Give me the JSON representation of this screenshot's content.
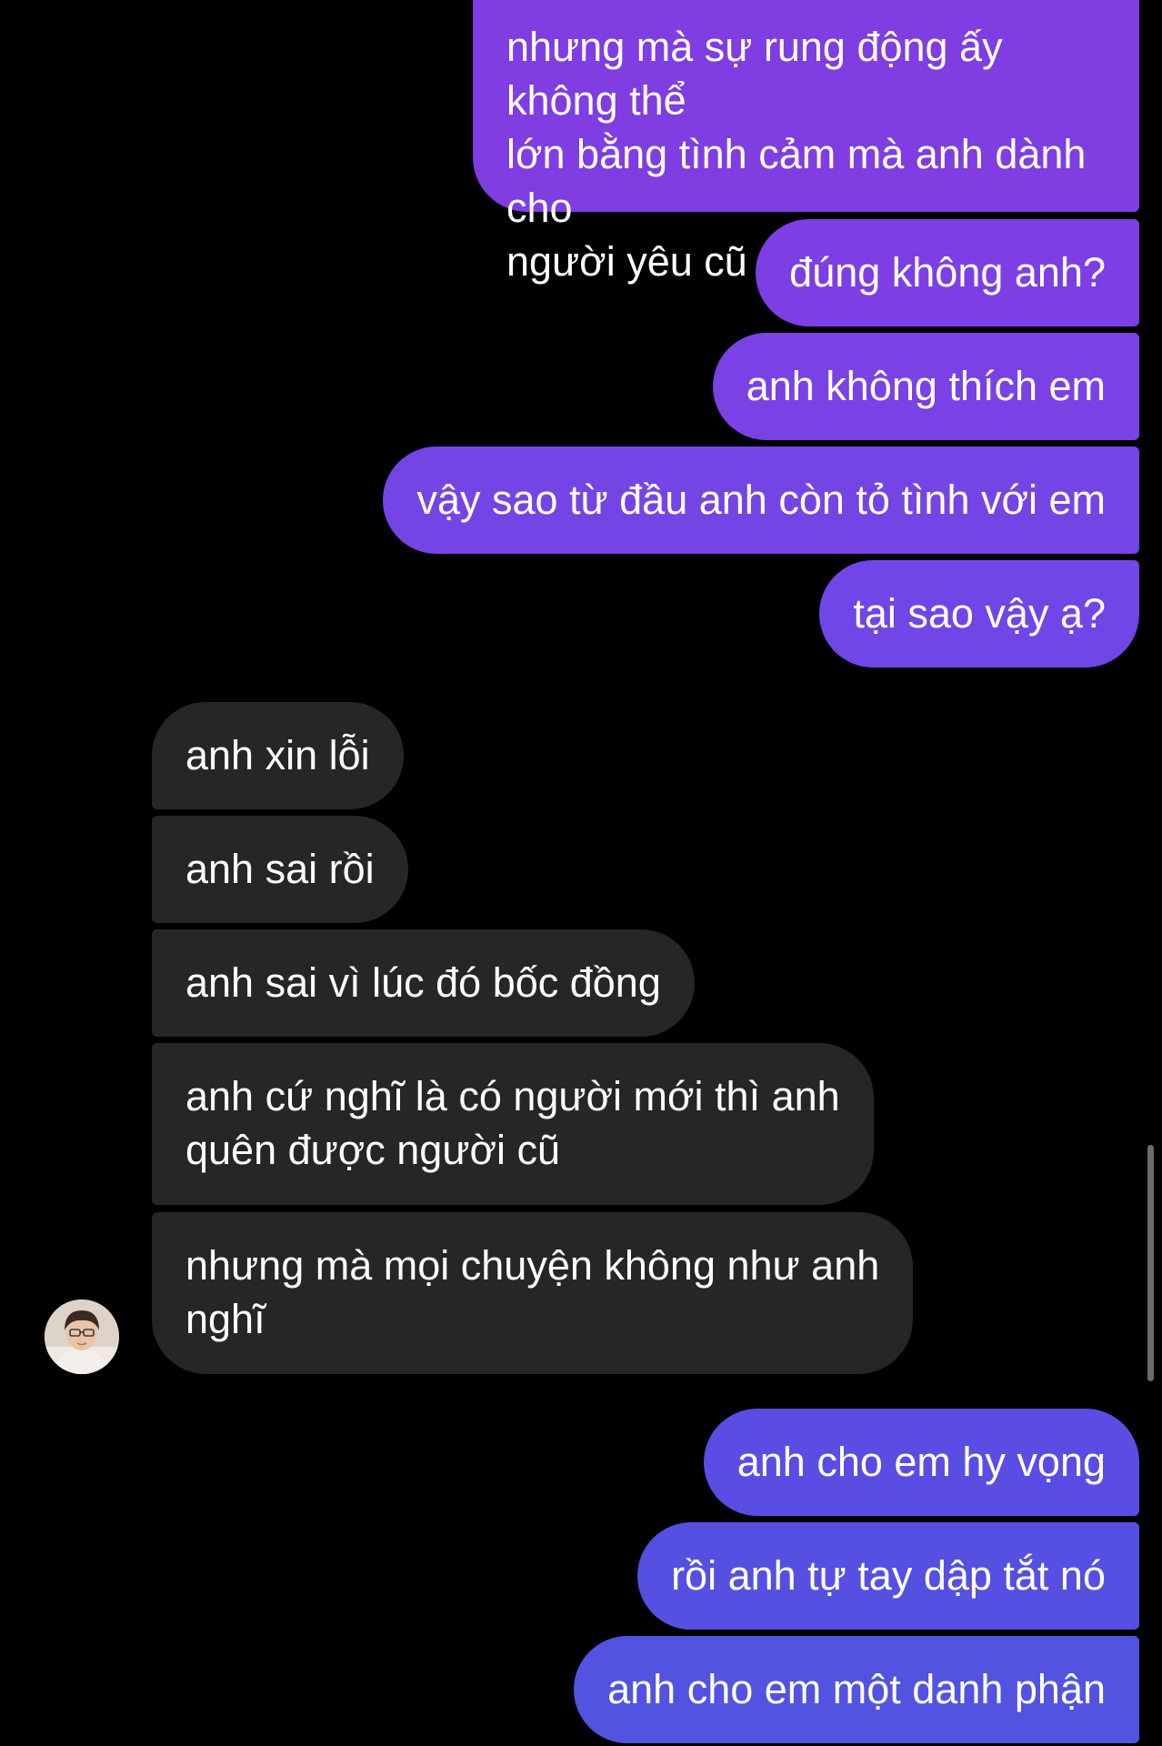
{
  "thread": {
    "colors": {
      "background": "#000000",
      "incoming_bubble": "#262626",
      "outgoing_purple": "#7f3de2",
      "outgoing_violet": "#6b45e6",
      "outgoing_blue": "#5253e0",
      "text": "#ffffff"
    },
    "messages": [
      {
        "sender": "me",
        "text": "nhưng mà sự rung động ấy không thể\nlớn bằng tình cảm mà anh dành cho\nngười yêu cũ"
      },
      {
        "sender": "me",
        "text": "đúng không anh?"
      },
      {
        "sender": "me",
        "text": "anh không thích em"
      },
      {
        "sender": "me",
        "text": "vậy sao từ đầu anh còn tỏ tình với em"
      },
      {
        "sender": "me",
        "text": "tại sao vậy ạ?"
      },
      {
        "sender": "them",
        "text": "anh xin lỗi"
      },
      {
        "sender": "them",
        "text": "anh sai rồi"
      },
      {
        "sender": "them",
        "text": "anh sai vì lúc đó bốc đồng"
      },
      {
        "sender": "them",
        "text": "anh cứ nghĩ là có người mới thì anh\nquên được người cũ"
      },
      {
        "sender": "them",
        "text": "nhưng mà mọi chuyện không như anh\nnghĩ"
      },
      {
        "sender": "me",
        "text": "anh cho em hy vọng"
      },
      {
        "sender": "me",
        "text": "rồi anh tự tay dập tắt nó"
      },
      {
        "sender": "me",
        "text": "anh cho em một danh phận"
      }
    ],
    "avatar_icon": "profile-photo-icon"
  }
}
